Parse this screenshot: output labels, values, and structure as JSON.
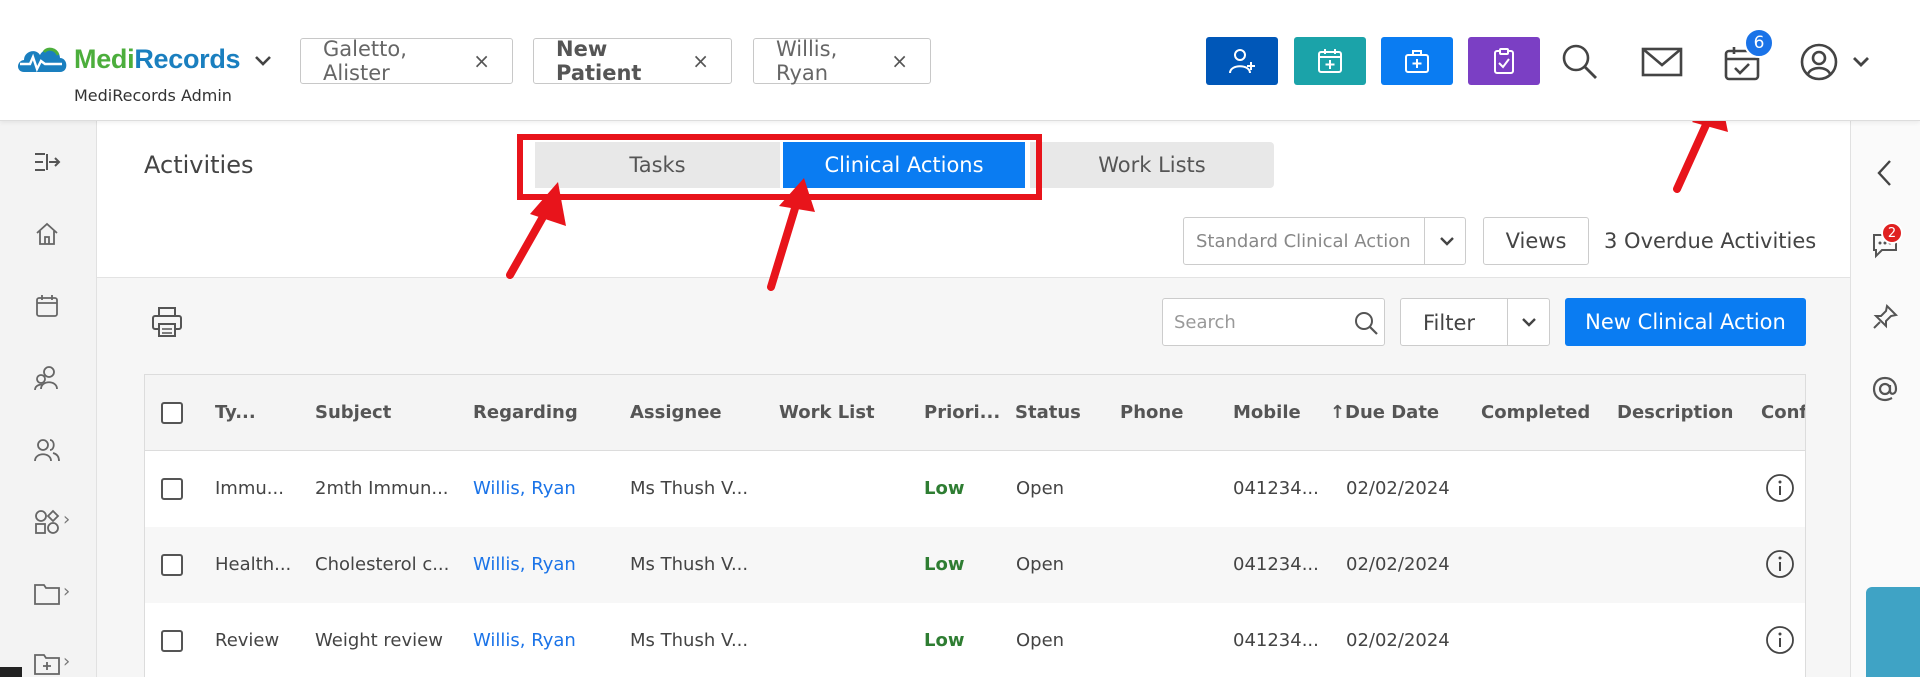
{
  "header": {
    "logo": {
      "part1": "Medi",
      "part2": "Records"
    },
    "subtitle": "MediRecords Admin",
    "patient_tabs": [
      {
        "label": "Galetto, Alister",
        "bold": false
      },
      {
        "label": "New Patient",
        "bold": true
      },
      {
        "label": "Willis, Ryan",
        "bold": false
      }
    ],
    "tab_close": "×",
    "action_buttons": [
      {
        "icon": "add-person-icon",
        "color": "#0057b8"
      },
      {
        "icon": "calendar-plus-icon",
        "color": "#1ba3a9"
      },
      {
        "icon": "medical-kit-icon",
        "color": "#0a7cf2"
      },
      {
        "icon": "clipboard-check-icon",
        "color": "#7b3fc4"
      }
    ],
    "activities_badge": "6"
  },
  "main": {
    "title": "Activities",
    "segments": [
      {
        "label": "Tasks",
        "active": false
      },
      {
        "label": "Clinical Actions",
        "active": true
      },
      {
        "label": "Work Lists",
        "active": false
      }
    ],
    "action_type_placeholder": "Standard Clinical Action",
    "views_label": "Views",
    "overdue_text": "3 Overdue Activities",
    "search_placeholder": "Search",
    "filter_label": "Filter",
    "new_button_label": "New Clinical Action"
  },
  "table": {
    "columns": [
      "Ty...",
      "Subject",
      "Regarding",
      "Assignee",
      "Work List",
      "Priori...",
      "Status",
      "Phone",
      "Mobile",
      "Due Date",
      "Completed",
      "Description",
      "Conf"
    ],
    "sort_indicator": "↑",
    "rows": [
      {
        "type": "Immu...",
        "subject": "2mth Immun...",
        "regarding": "Willis, Ryan",
        "assignee": "Ms Thush V...",
        "work_list": "",
        "priority": "Low",
        "status": "Open",
        "phone": "",
        "mobile": "041234...",
        "due_date": "02/02/2024",
        "completed": "",
        "description": ""
      },
      {
        "type": "Health...",
        "subject": "Cholesterol c...",
        "regarding": "Willis, Ryan",
        "assignee": "Ms Thush V...",
        "work_list": "",
        "priority": "Low",
        "status": "Open",
        "phone": "",
        "mobile": "041234...",
        "due_date": "02/02/2024",
        "completed": "",
        "description": ""
      },
      {
        "type": "Review",
        "subject": "Weight review",
        "regarding": "Willis, Ryan",
        "assignee": "Ms Thush V...",
        "work_list": "",
        "priority": "Low",
        "status": "Open",
        "phone": "",
        "mobile": "041234...",
        "due_date": "02/02/2024",
        "completed": "",
        "description": ""
      }
    ]
  },
  "right_sidebar": {
    "chat_badge": "2"
  },
  "colors": {
    "accent": "#0a7cf2",
    "annotation": "#e8141b",
    "low_priority": "#2e7d32",
    "link": "#1a73e8"
  }
}
